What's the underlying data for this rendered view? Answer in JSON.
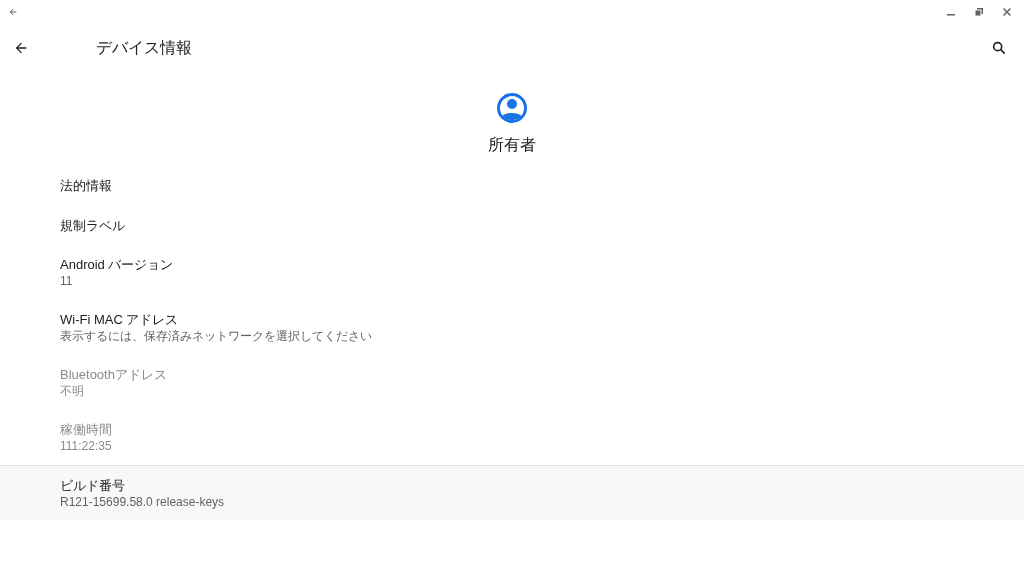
{
  "app_bar": {
    "title": "デバイス情報"
  },
  "header": {
    "name": "所有者"
  },
  "items": [
    {
      "title": "法的情報",
      "disabled": false,
      "selected": false
    },
    {
      "title": "規制ラベル",
      "disabled": false,
      "selected": false
    },
    {
      "title": "Android バージョン",
      "summary": "11",
      "disabled": false,
      "selected": false
    },
    {
      "title": "Wi-Fi MAC アドレス",
      "summary": "表示するには、保存済みネットワークを選択してください",
      "disabled": false,
      "selected": false
    },
    {
      "title": "Bluetoothアドレス",
      "summary": "不明",
      "disabled": true,
      "selected": false
    },
    {
      "title": "稼働時間",
      "summary": "111:22:35",
      "disabled": true,
      "selected": false
    },
    {
      "title": "ビルド番号",
      "summary": "R121-15699.58.0 release-keys",
      "disabled": false,
      "selected": true
    }
  ]
}
